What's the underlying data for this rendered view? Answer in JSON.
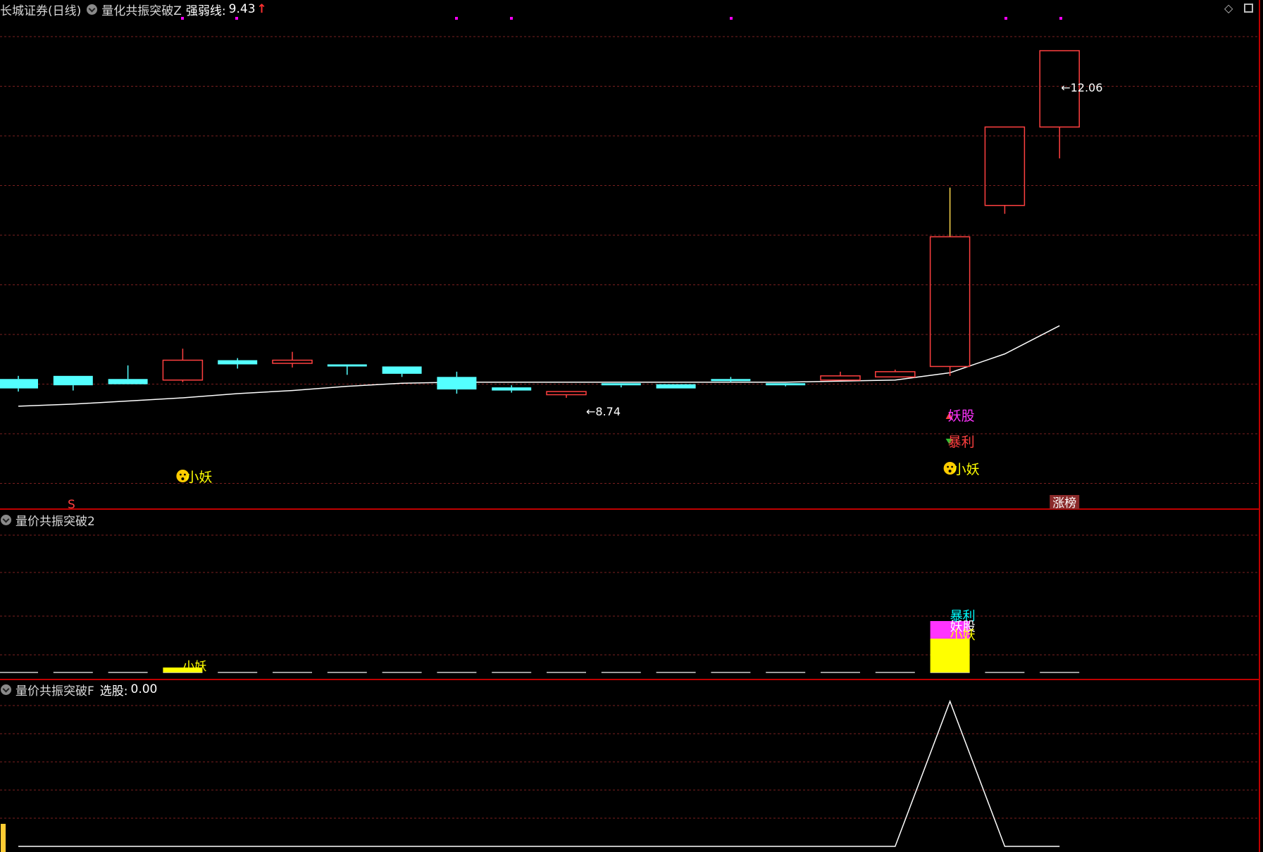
{
  "panel1": {
    "stock": "长城证券(日线)",
    "indicator": "量化共振突破Z",
    "line_label": "强弱线:",
    "line_value": "9.43",
    "high_label": "12.06",
    "low_label": "8.74",
    "sig_yaogu": "妖股",
    "sig_baoli": "暴利",
    "sig_xiaoyao": "小妖",
    "sig_xiaoyao_left": "小妖",
    "sig_s": "S",
    "sig_zhangting": "涨榜"
  },
  "panel2": {
    "title": "量价共振突破2",
    "sig_baoli": "暴利",
    "sig_yaogu": "妖股",
    "sig_xiaoyao": "小妖",
    "sig_xiaoyao_left": "小妖"
  },
  "panel3": {
    "title": "量价共振突破F",
    "line_label": "选股:",
    "line_value": "0.00"
  },
  "colors": {
    "up": "#ff4040",
    "down": "#54ffff",
    "grid": "#7a1f1f",
    "divider": "#c00000",
    "ma": "#ffffff",
    "marker": "#ff00ff",
    "yellow": "#ffff00",
    "magenta": "#ff33ff",
    "cyan": "#00ffff"
  },
  "chart_data": {
    "type": "candlestick",
    "price_axis_reference": {
      "high": 12.06,
      "low": 8.74,
      "line": 9.43
    },
    "candles": [
      {
        "open": 8.92,
        "close": 8.83,
        "high": 8.95,
        "low": 8.8
      },
      {
        "open": 8.95,
        "close": 8.86,
        "high": 8.95,
        "low": 8.81
      },
      {
        "open": 8.92,
        "close": 8.87,
        "high": 9.05,
        "low": 8.87
      },
      {
        "open": 8.91,
        "close": 9.1,
        "high": 9.21,
        "low": 8.89
      },
      {
        "open": 9.1,
        "close": 9.06,
        "high": 9.12,
        "low": 9.02
      },
      {
        "open": 9.07,
        "close": 9.1,
        "high": 9.18,
        "low": 9.03
      },
      {
        "open": 9.06,
        "close": 9.04,
        "high": 9.06,
        "low": 8.96
      },
      {
        "open": 9.04,
        "close": 8.97,
        "high": 9.04,
        "low": 8.94
      },
      {
        "open": 8.94,
        "close": 8.82,
        "high": 8.99,
        "low": 8.78
      },
      {
        "open": 8.84,
        "close": 8.81,
        "high": 8.86,
        "low": 8.79
      },
      {
        "open": 8.77,
        "close": 8.8,
        "high": 8.8,
        "low": 8.74
      },
      {
        "open": 8.88,
        "close": 8.86,
        "high": 8.88,
        "low": 8.84
      },
      {
        "open": 8.87,
        "close": 8.83,
        "high": 8.87,
        "low": 8.83
      },
      {
        "open": 8.92,
        "close": 8.91,
        "high": 8.94,
        "low": 8.89
      },
      {
        "open": 8.88,
        "close": 8.86,
        "high": 8.88,
        "low": 8.85
      },
      {
        "open": 8.91,
        "close": 8.95,
        "high": 8.99,
        "low": 8.91
      },
      {
        "open": 8.94,
        "close": 8.99,
        "high": 9.01,
        "low": 8.94
      },
      {
        "open": 9.04,
        "close": 10.28,
        "high": 10.75,
        "low": 8.95
      },
      {
        "open": 10.58,
        "close": 11.33,
        "high": 11.33,
        "low": 10.5
      },
      {
        "open": 11.33,
        "close": 12.06,
        "high": 12.06,
        "low": 11.03
      }
    ],
    "strength_line": [
      8.66,
      8.68,
      8.71,
      8.74,
      8.78,
      8.81,
      8.85,
      8.88,
      8.89,
      8.89,
      8.89,
      8.89,
      8.89,
      8.89,
      8.89,
      8.9,
      8.91,
      8.98,
      9.16,
      9.43
    ],
    "signal_bars": [
      0,
      0,
      0,
      1,
      0,
      0,
      0,
      0,
      0,
      0,
      0,
      0,
      0,
      0,
      0,
      0,
      0,
      3,
      0,
      0
    ],
    "xuangu": [
      0,
      0,
      0,
      0,
      0,
      0,
      0,
      0,
      0,
      0,
      0,
      0,
      0,
      0,
      0,
      0,
      0,
      1,
      0,
      0
    ],
    "signals": [
      {
        "index": 3,
        "labels": [
          "小妖"
        ]
      },
      {
        "index": 17,
        "labels": [
          "妖股",
          "暴利",
          "小妖"
        ]
      },
      {
        "index": 19,
        "labels": [
          "涨榜"
        ]
      }
    ]
  }
}
